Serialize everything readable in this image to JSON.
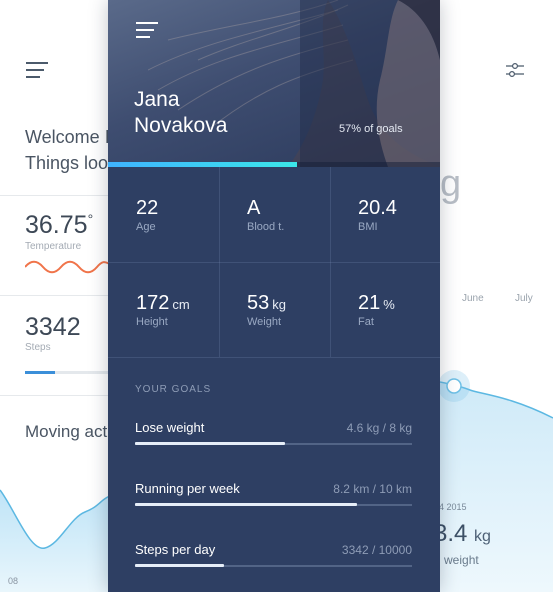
{
  "left_card": {
    "welcome_line1": "Welcome I",
    "welcome_line2": "Things loo",
    "temperature_value": "36.75",
    "temperature_unit": "°",
    "temperature_label": "Temperature",
    "steps_value": "3342",
    "steps_label": "Steps",
    "steps_progress": 0.35,
    "moving_title": "Moving act",
    "chart_tick": "08"
  },
  "profile": {
    "first_name": "Jana",
    "last_name": "Novakova",
    "goals_percent_text": "57% of goals",
    "goals_progress": 0.57,
    "stats": [
      {
        "value": "22",
        "unit": "",
        "label": "Age"
      },
      {
        "value": "A",
        "unit": "",
        "label": "Blood t."
      },
      {
        "value": "20.4",
        "unit": "",
        "label": "BMI"
      },
      {
        "value": "172",
        "unit": "cm",
        "label": "Height"
      },
      {
        "value": "53",
        "unit": "kg",
        "label": "Weight"
      },
      {
        "value": "21",
        "unit": "%",
        "label": "Fat"
      }
    ]
  },
  "goals": {
    "title": "YOUR GOALS",
    "items": [
      {
        "name": "Lose weight",
        "value": "4.6 kg / 8 kg",
        "progress": 0.54
      },
      {
        "name": "Running per week",
        "value": "8.2 km / 10 km",
        "progress": 0.8
      },
      {
        "name": "Steps per day",
        "value": "3342 / 10000",
        "progress": 0.32
      }
    ]
  },
  "right_card": {
    "big_text": "g",
    "months": [
      "June",
      "July"
    ],
    "date_text": "14 2015",
    "weight_value": "3.4",
    "weight_unit": "kg",
    "weight_label": "n weight"
  },
  "colors": {
    "card_bg": "#2e3f63",
    "accent_cyan": "#3be7e9",
    "accent_blue": "#3b8fd9",
    "wave_orange": "#f0744a"
  },
  "icons": [
    "menu-icon",
    "filter-icon"
  ]
}
